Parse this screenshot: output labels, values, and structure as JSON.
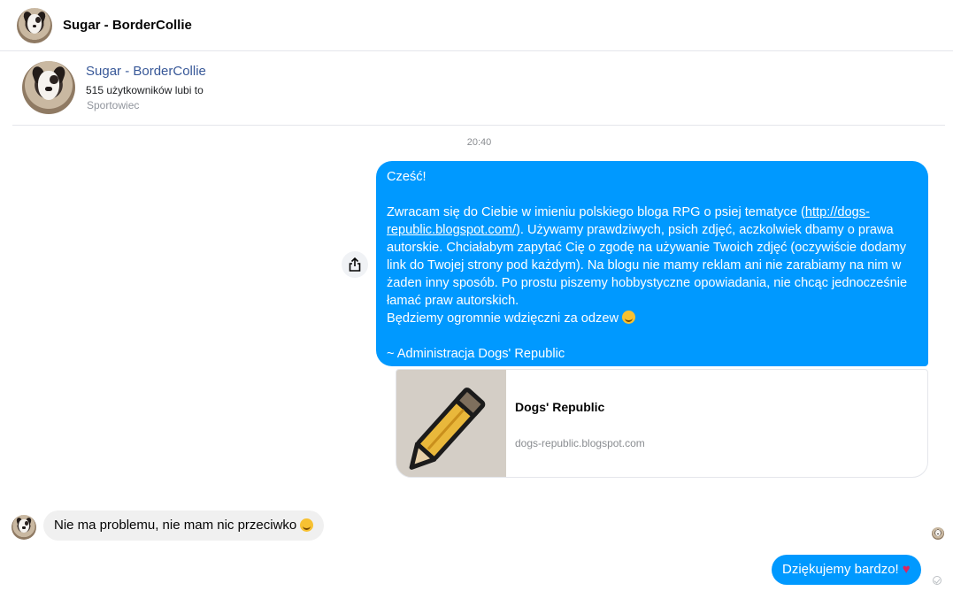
{
  "header": {
    "title": "Sugar - BorderCollie"
  },
  "profile": {
    "name": "Sugar - BorderCollie",
    "likes": "515 użytkowników lubi to",
    "category": "Sportowiec"
  },
  "conversation": {
    "timestamp": "20:40",
    "outgoing_message": {
      "greeting": "Cześć!",
      "body_before_link": "Zwracam się do Ciebie w imieniu polskiego bloga RPG o psiej tematyce (",
      "link_text": "http://dogs-republic.blogspot.com/",
      "body_after_link": "). Używamy prawdziwych, psich zdjęć, aczkolwiek dbamy o prawa autorskie. Chciałabym zapytać Cię o zgodę na używanie Twoich zdjęć (oczywiście dodamy link do Twojej strony pod każdym). Na blogu nie mamy reklam ani nie zarabiamy na nim w żaden inny sposób. Po prostu piszemy hobbystyczne opowiadania, nie chcąc jednocześnie łamać praw autorskich.",
      "thanks_line": "Będziemy ogromnie wdzięczni za odzew",
      "signature": "~ Administracja Dogs' Republic"
    },
    "link_preview": {
      "title": "Dogs' Republic",
      "domain": "dogs-republic.blogspot.com"
    },
    "incoming_message": {
      "text": "Nie ma problemu, nie mam nic przeciwko"
    },
    "reply_message": {
      "text": "Dziękujemy bardzo!",
      "emoji": "♥"
    }
  },
  "colors": {
    "outgoing_bubble": "#0099ff",
    "incoming_bubble": "#f0f0f0",
    "profile_link": "#385898"
  },
  "icons": {
    "share": "share-icon",
    "sent_status": "sent-check-icon"
  }
}
